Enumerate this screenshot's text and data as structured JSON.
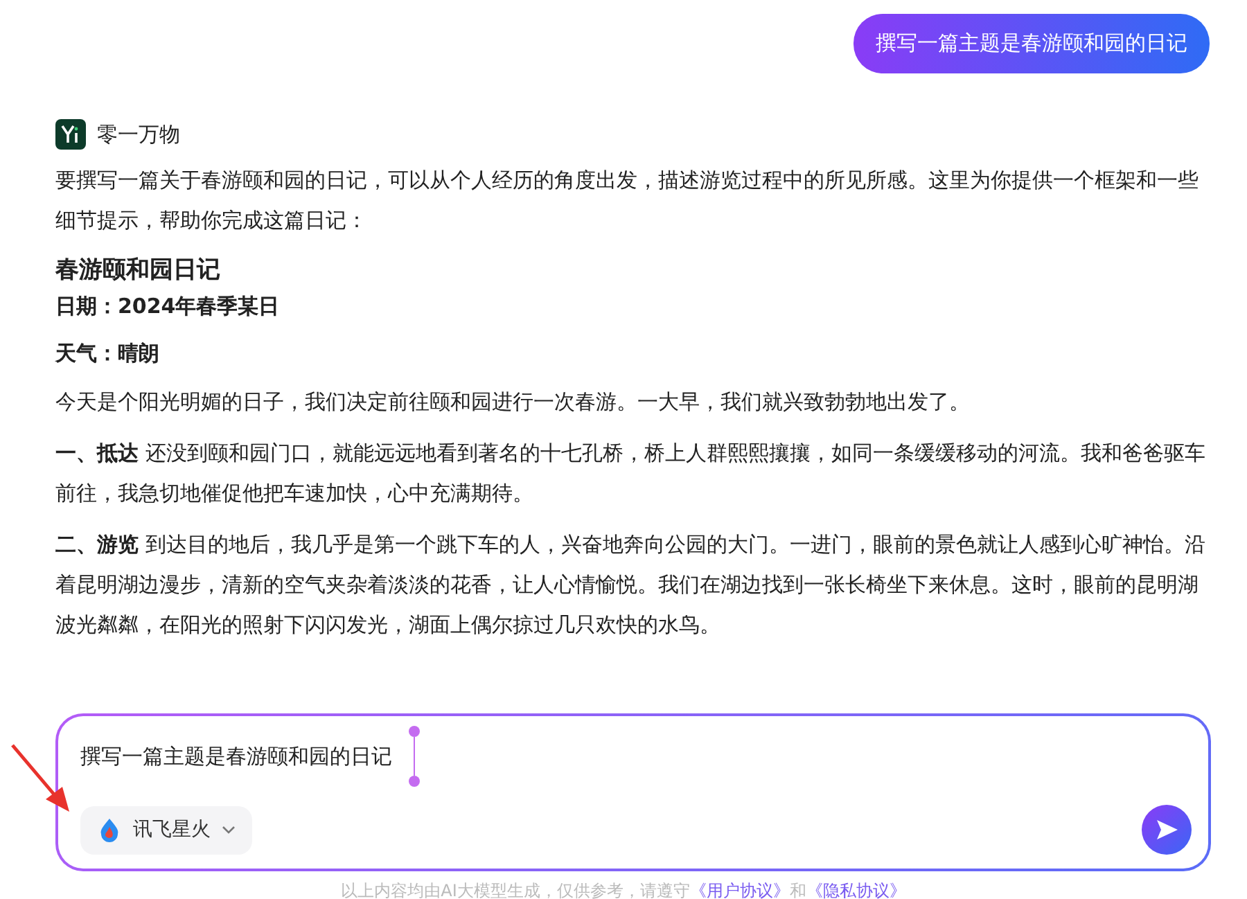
{
  "user_message": {
    "text": "撰写一篇主题是春游颐和园的日记"
  },
  "assistant": {
    "name": "零一万物",
    "intro": "要撰写一篇关于春游颐和园的日记，可以从个人经历的角度出发，描述游览过程中的所见所感。这里为你提供一个框架和一些细节提示，帮助你完成这篇日记：",
    "title": "春游颐和园日记",
    "meta": [
      "日期：2024年春季某日",
      "天气：晴朗"
    ],
    "paragraphs": [
      "今天是个阳光明媚的日子，我们决定前往颐和园进行一次春游。一大早，我们就兴致勃勃地出发了。",
      "**一、抵达** 还没到颐和园门口，就能远远地看到著名的十七孔桥，桥上人群熙熙攘攘，如同一条缓缓移动的河流。我和爸爸驱车前往，我急切地催促他把车速加快，心中充满期待。",
      "**二、游览** 到达目的地后，我几乎是第一个跳下车的人，兴奋地奔向公园的大门。一进门，眼前的景色就让人感到心旷神怡。沿着昆明湖边漫步，清新的空气夹杂着淡淡的花香，让人心情愉悦。我们在湖边找到一张长椅坐下来休息。这时，眼前的昆明湖波光粼粼，在阳光的照射下闪闪发光，湖面上偶尔掠过几只欢快的水鸟。"
    ]
  },
  "composer": {
    "value": "撰写一篇主题是春游颐和园的日记",
    "model": "讯飞星火"
  },
  "disclaimer": [
    {
      "kind": "text",
      "text": "以上内容均由AI大模型生成，仅供参考，请遵守"
    },
    {
      "kind": "link",
      "text": "《用户协议》"
    },
    {
      "kind": "text",
      "text": "和"
    },
    {
      "kind": "link",
      "text": "《隐私协议》"
    }
  ]
}
